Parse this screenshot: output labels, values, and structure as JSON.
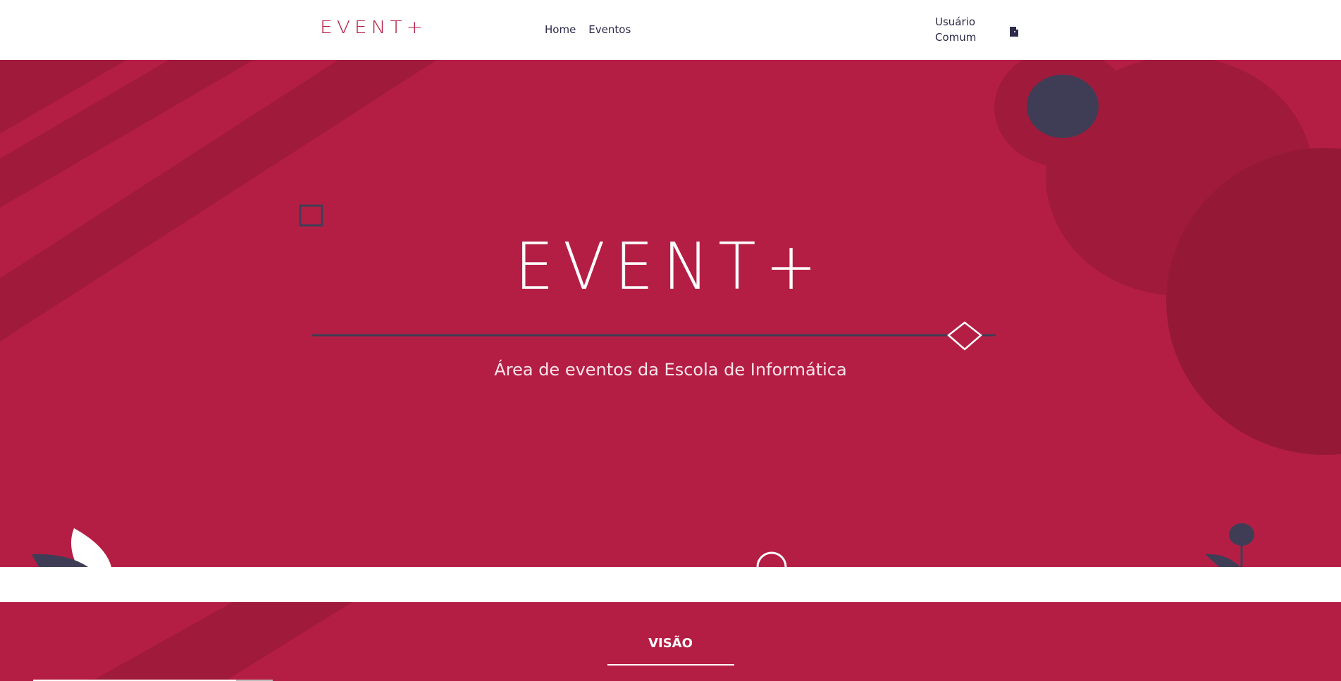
{
  "header": {
    "logo": "EVENT+",
    "nav": [
      {
        "label": "Home"
      },
      {
        "label": "Eventos"
      }
    ],
    "user_name": "Usuário Comum",
    "logout_icon": "door-exit-icon"
  },
  "hero": {
    "logo": "EVENT+",
    "subtitle": "Área de eventos da Escola de Informática"
  },
  "vision": {
    "title": "VISÃO"
  },
  "colors": {
    "brand": "#b51e44",
    "brand_dark": "#a01a3b",
    "navy": "#3f3d56",
    "text": "#2c2a4a"
  }
}
